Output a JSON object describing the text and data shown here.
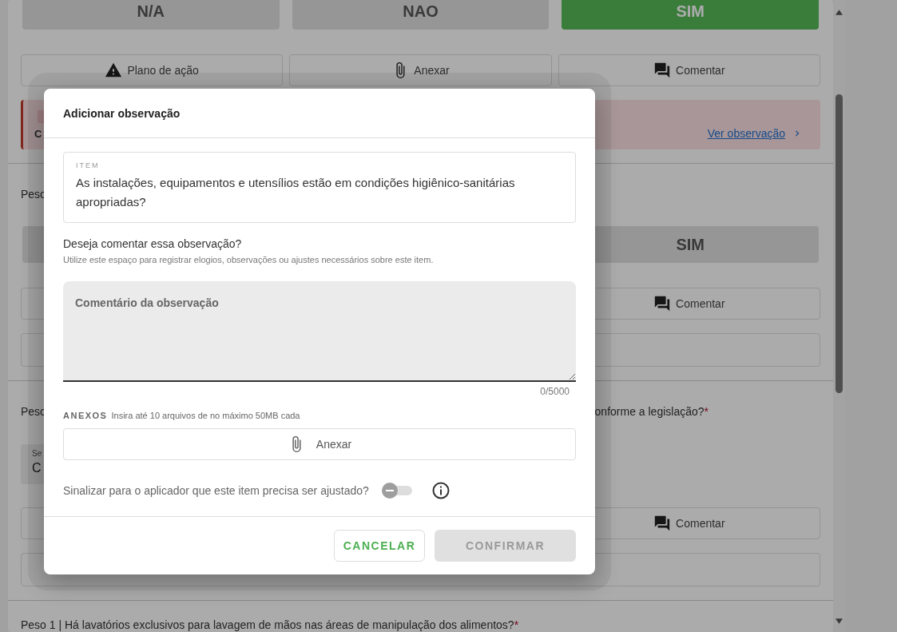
{
  "page": {
    "sections": [
      {
        "answers": [
          {
            "label": "N/A",
            "selected": false
          },
          {
            "label": "NAO",
            "selected": false
          },
          {
            "label": "SIM",
            "selected": true
          }
        ],
        "actions": [
          {
            "label": "Plano de ação",
            "kind": "plan"
          },
          {
            "label": "Anexar",
            "kind": "attach"
          },
          {
            "label": "Comentar",
            "kind": "comment"
          }
        ],
        "observation": {
          "text": "C",
          "link": "Ver observação"
        }
      },
      {
        "question": "Peso",
        "answers": [
          {
            "label": "SIM",
            "selected": false
          }
        ],
        "actions": [
          {
            "label": "Comentar",
            "kind": "comment"
          }
        ],
        "extra_box": true
      },
      {
        "question": "Peso",
        "question_end": "onforme a legislação?",
        "required_mark": "*",
        "select": {
          "label": "Se",
          "value": "C"
        },
        "actions": [
          {
            "label": "Comentar",
            "kind": "comment"
          }
        ],
        "extra_box": true
      },
      {
        "question": "Peso 1 | Há lavatórios exclusivos para lavagem de mãos nas áreas de manipulação dos alimentos?",
        "required_mark": "*"
      }
    ]
  },
  "modal": {
    "title": "Adicionar observação",
    "item_label": "ITEM",
    "item_text": "As instalações, equipamentos e utensílios estão em condições higiênico-sanitárias apropriadas?",
    "prompt": "Deseja comentar essa observação?",
    "hint": "Utilize este espaço para registrar elogios, observações ou ajustes necessários sobre este item.",
    "comment": {
      "placeholder": "Comentário da observação",
      "counter": "0/5000"
    },
    "attachments": {
      "label": "ANEXOS",
      "hint": "Insira até 10 arquivos de no máximo 50MB cada",
      "button": "Anexar"
    },
    "flag": {
      "label": "Sinalizar para o aplicador que este item precisa ser ajustado?",
      "on": false
    },
    "buttons": [
      {
        "label": "CANCELAR",
        "kind": "outlined",
        "disabled": false
      },
      {
        "label": "CONFIRMAR",
        "kind": "filled",
        "disabled": true
      }
    ]
  }
}
